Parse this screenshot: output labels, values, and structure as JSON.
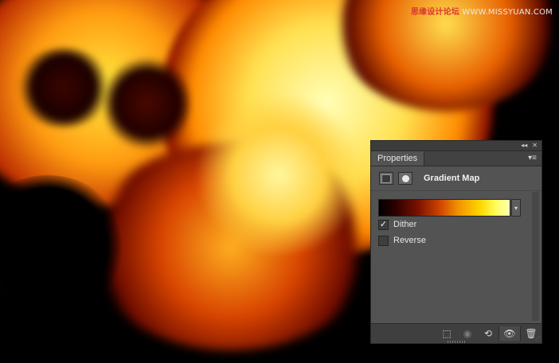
{
  "watermark": {
    "cn": "思缘设计论坛",
    "url": "WWW.MISSYUAN.COM"
  },
  "panel_controls": {
    "collapse_icon": "double-chevron-left-icon",
    "collapse": "◂◂",
    "close": "✕"
  },
  "panel": {
    "tab_label": "Properties",
    "menu_icon": "panel-menu-icon",
    "menu_glyph": "▾≡",
    "title": "Gradient Map",
    "adjustment_icon": "adjustment-layer-icon",
    "mask_icon": "layer-mask-icon",
    "gradient": {
      "stops": [
        "#000000",
        "#7a1200",
        "#d44a00",
        "#f09000",
        "#ffd800",
        "#ffffb0"
      ],
      "dropdown_glyph": "▾"
    },
    "options": [
      {
        "label": "Dither",
        "checked": true,
        "check_glyph": "✓"
      },
      {
        "label": "Reverse",
        "checked": false,
        "check_glyph": ""
      }
    ]
  },
  "footer": {
    "buttons": [
      {
        "name": "clip-to-layer-icon",
        "glyph": "⬚"
      },
      {
        "name": "view-previous-state-icon",
        "glyph": "◉"
      },
      {
        "name": "reset-icon",
        "glyph": "⟲"
      },
      {
        "name": "visibility-eye-icon",
        "glyph": "👁"
      },
      {
        "name": "trash-icon",
        "glyph": "🗑"
      }
    ]
  }
}
